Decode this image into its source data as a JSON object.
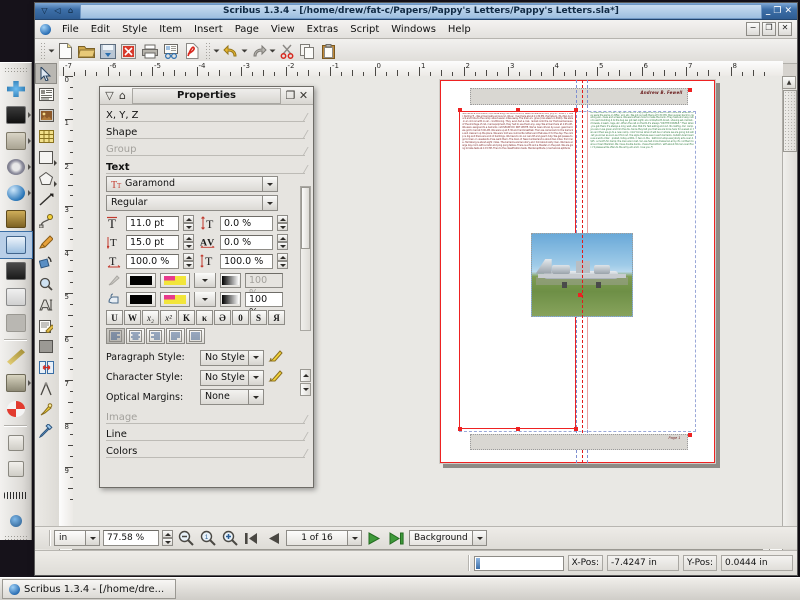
{
  "window": {
    "title": "Scribus 1.3.4 - [/home/drew/fat-c/Papers/Pappy's Letters/Pappy's Letters.sla*]",
    "minimize_glyph": "_",
    "maximize_glyph": "❐",
    "close_glyph": "✕",
    "shade_glyph": "▽",
    "sticky_glyph": "⌂",
    "menu_glyph": "◁"
  },
  "menubar": {
    "items": [
      {
        "label": "File"
      },
      {
        "label": "Edit"
      },
      {
        "label": "Style"
      },
      {
        "label": "Item"
      },
      {
        "label": "Insert"
      },
      {
        "label": "Page"
      },
      {
        "label": "View"
      },
      {
        "label": "Extras"
      },
      {
        "label": "Script"
      },
      {
        "label": "Windows"
      },
      {
        "label": "Help"
      }
    ],
    "mdi_minimize": "−",
    "mdi_restore": "❐",
    "mdi_close": "✕"
  },
  "toolbar": {
    "items": [
      {
        "name": "new-document-icon"
      },
      {
        "name": "open-document-icon"
      },
      {
        "name": "save-document-icon"
      },
      {
        "name": "close-document-icon"
      },
      {
        "name": "print-document-icon"
      },
      {
        "name": "print-preview-icon"
      },
      {
        "name": "export-pdf-icon"
      },
      {
        "name": "undo-icon"
      },
      {
        "name": "redo-icon"
      },
      {
        "name": "cut-icon"
      },
      {
        "name": "copy-icon"
      },
      {
        "name": "paste-icon"
      }
    ]
  },
  "toolpalette": {
    "items": [
      {
        "name": "select-item-tool",
        "selected": true
      },
      {
        "name": "text-frame-tool",
        "selected": false
      },
      {
        "name": "image-frame-tool",
        "selected": false
      },
      {
        "name": "table-tool",
        "selected": false
      },
      {
        "name": "shape-tool",
        "selected": false,
        "has_menu": true
      },
      {
        "name": "polygon-tool",
        "selected": false,
        "has_menu": true
      },
      {
        "name": "line-tool",
        "selected": false
      },
      {
        "name": "bezier-curve-tool",
        "selected": false
      },
      {
        "name": "freehand-line-tool",
        "selected": false
      },
      {
        "name": "rotate-item-tool",
        "selected": false
      },
      {
        "name": "zoom-tool",
        "selected": false
      },
      {
        "name": "edit-contents-tool",
        "selected": false
      },
      {
        "name": "edit-text-story-editor-tool",
        "selected": false
      },
      {
        "name": "link-text-frames-tool",
        "selected": false
      },
      {
        "name": "unlink-text-frames-tool",
        "selected": false
      },
      {
        "name": "measurements-tool",
        "selected": false
      },
      {
        "name": "copy-item-properties-tool",
        "selected": false
      },
      {
        "name": "eye-dropper-tool",
        "selected": false
      }
    ]
  },
  "rulers": {
    "unit": "in",
    "horizontal_labels": [
      "-7",
      "-6",
      "-5",
      "-4",
      "-3",
      "-2",
      "-1",
      "0",
      "1",
      "2",
      "3",
      "4",
      "5",
      "6",
      "7",
      "8"
    ],
    "vertical_labels": [
      "0",
      "1",
      "2",
      "3",
      "4",
      "5",
      "6",
      "7",
      "8",
      "9"
    ]
  },
  "properties_palette": {
    "title": "Properties",
    "shade_glyph": "▽",
    "float_glyph": "⌂",
    "maximize_glyph": "❐",
    "close_glyph": "✕",
    "sections": [
      {
        "label": "X, Y, Z",
        "enabled": true
      },
      {
        "label": "Shape",
        "enabled": true
      },
      {
        "label": "Group",
        "enabled": false
      },
      {
        "label": "Text",
        "enabled": true,
        "expanded": true
      }
    ],
    "bottom_sections": [
      {
        "label": "Image",
        "enabled": false
      },
      {
        "label": "Line",
        "enabled": true
      },
      {
        "label": "Colors",
        "enabled": true
      }
    ],
    "text": {
      "font_family": "Garamond",
      "font_style": "Regular",
      "font_size": "11.0 pt",
      "line_spacing": "15.0 pt",
      "tracking": "0.0 %",
      "baseline_offset": "0.0 %",
      "scale_horizontal": "100.0 %",
      "scale_vertical": "100.0 %",
      "fill_shade": "100 %",
      "stroke_shade": "100 %",
      "style_buttons": [
        {
          "name": "underline-button",
          "glyph": "U"
        },
        {
          "name": "underline-words-button",
          "glyph": "W"
        },
        {
          "name": "subscript-button",
          "glyph": "x₂"
        },
        {
          "name": "superscript-button",
          "glyph": "x²"
        },
        {
          "name": "all-caps-button",
          "glyph": "K"
        },
        {
          "name": "small-caps-button",
          "glyph": "κ"
        },
        {
          "name": "strikethrough-button",
          "glyph": "Ə"
        },
        {
          "name": "outline-text-button",
          "glyph": "0"
        },
        {
          "name": "shadowed-text-button",
          "glyph": "S"
        },
        {
          "name": "mirror-text-button",
          "glyph": "Я"
        }
      ],
      "align_buttons": [
        {
          "name": "align-left-button",
          "active": true
        },
        {
          "name": "align-center-button",
          "active": false
        },
        {
          "name": "align-right-button",
          "active": false
        },
        {
          "name": "align-block-button",
          "active": false
        },
        {
          "name": "align-forced-button",
          "active": false
        }
      ],
      "paragraph_style_label": "Paragraph Style:",
      "paragraph_style_value": "No Style",
      "character_style_label": "Character Style:",
      "character_style_value": "No Style",
      "optical_margins_label": "Optical Margins:",
      "optical_margins_value": "None"
    }
  },
  "document": {
    "header_text": "Andrew B. Fewell",
    "footer_text": "Page 1",
    "left_column_lines": [
      "Sub·Service·Command¶",
      "R/O·Area·Bldg·312·Room·1470¶",
      "New·Cumberland,·PA¶",
      "July·27,·1944¶",
      "¶",
      "Dear·Darling,¶",
      "→We·arrived·safe·and·sound.·We·ar-",
      "rived·here·about·11:30·PM.·Harrisburg,",
      "PA.·Men·by·truck·and·rode·to·the·camp",
      "about·seven·miles·away.·The·train·en-",
      "gine·(coal-steam·in·1944).·We·were·in·an",
      "old·car·with·no·air-",
      "conditioning.·They",
      "even·had·a·coal-",
      "racked·onto·the·car",
      "that·real·because·of",
      "the·shortage·of·rail-",
      "road·equipment,·they",
      "had·to·use·them·any-",
      "way.·We·arrived·here",
      "at·1:45·AM.·We·were",
      "assigned·to·a·barracks",
      "cat·PLEASE·DO",
      "NOT·WRITE.·We've",
      "been·driven·by·a·ser-",
      "geant·and·we·got·to",
      "bed·at·3:00·AM.·We",
      "were·up·at·5:30·and",
      "had·breakfast.·Then",
      "we·came·back·to·the",
      "barracks·and·cleaned",
      "up·the·place.·We·were",
      "told·we·could·write",
      "letters·and·that·was·it",
      "for·the·day.·The·camp",
      "is·big·and·there·are·a·lot·of·buildings.",
      "We·have·to·do·our·own·KP·and·guard",
      "duty.·We·get·passes·to·go·to·town·on",
      "weekends·if·we·want·them.·The·town·of",
      "New·Cumberland·is·about·two·miles",
      "from·here.·Harrisburg·is·about·eight",
      "miles.·The·barracks·are·two·story·and",
      "hold·about·sixty·men.·We·have·a·large",
      "day·room·with·a·radio·and·ping·pong",
      "tables.·There·is·a·PX·and·a·theater·on",
      "the·post.·We·are·going·to·take·tests·at·1:15",
      "PM.·Then·to·the·classification·tests.",
      "Mental·aptitude·/·mechanical·aptitude·"
    ],
    "right_column_lines": [
      "and·also·test·our·code.·They·had·a·record",
      "they·played·and·you·are·to·tell·if·sounds",
      "whether·they·were·the·same·or·differ-",
      "ent,·etc.·We·got·our·salt·there·at·5:30",
      "PM,·then·supper·back·to·cleaning·win-",
      "dows·and·screens.·We·were·shown·how",
      "to·make·the·bunk.·They·have·at·2-way",
      "radio·to·each·building·4·to·the·bug·we",
      "got·last·night;·six·combs/tooth·brush,",
      "shaving·set,·helmet,·2·towels,·2·wash-",
      "rags,·etc.·When·the·call·on·the·PA·it's",
      "always·\"ON·THE·DOUBLE.\"·Then",
      "when·you·get·there",
      "it's·always·a·long",
      "wait.·Also·that·it's",
      "fast·eating·and·out.",
      "No·loafing.·Our",
      "camp·you·are·in·we",
      "given·and·him·the·dis-",
      "tance·they·tell·you",
      "that·we·are·to·be·here",
      "for·a·week·or·two·and",
      "then·we·go·to·a·new",
      "camp.·I·don't·know",
      "when·it·will·be·or",
      "where·we·are·going",
      "but·will·let·you·know",
      "as·soon·as·I·find·out.",
      "the·signs·that·we·see·in·each·barracks.",
      "bulletin·board·same·as·a·work·order·",
      "posted,·today·a·WOL·=·two·on·the·",
      "bathroom·stop·everybody·acts·over·4·$15·",
      "a·month·for·Camp;·the·men·are·in·bet-",
      "ter,·we·had·more·Dukes·ten·army·it's",
      "northern·towns·or·town·Marshall.·We",
      "have·double·bunks.·I·have·the·bottom",
      "with·about·36·men·over·floor.·I'll",
      "please·write·often·to·the·army·etc·and·I·",
      "love·you.·¶"
    ]
  },
  "statusbar": {
    "unit_value": "in",
    "zoom_value": "77.58 %",
    "zoom_out_icon": "zoom-out-icon",
    "zoom_100_icon": "zoom-100-icon",
    "zoom_in_icon": "zoom-in-icon",
    "first_page_icon": "first-page-icon",
    "previous_page_icon": "previous-page-icon",
    "page_value": "1 of 16",
    "next_page_icon": "next-page-icon",
    "last_page_icon": "last-page-icon",
    "layer_value": "Background"
  },
  "infobar": {
    "xpos_label": "X-Pos:",
    "xpos_value": "-7.4247 in",
    "ypos_label": "Y-Pos:",
    "ypos_value": "0.0444 in"
  },
  "taskbar": {
    "items": [
      {
        "label": "Scribus 1.3.4 - [/home/dre...",
        "icon": "scribus-icon"
      }
    ]
  },
  "colors": {
    "titlebar_start": "#7fa9d6",
    "titlebar_end": "#2e5c92",
    "chrome": "#dedcd8",
    "page_border": "#ee2222",
    "guide": "#7f8fd0",
    "text_red": "#7d2222",
    "text_green": "#2e7a3c"
  }
}
